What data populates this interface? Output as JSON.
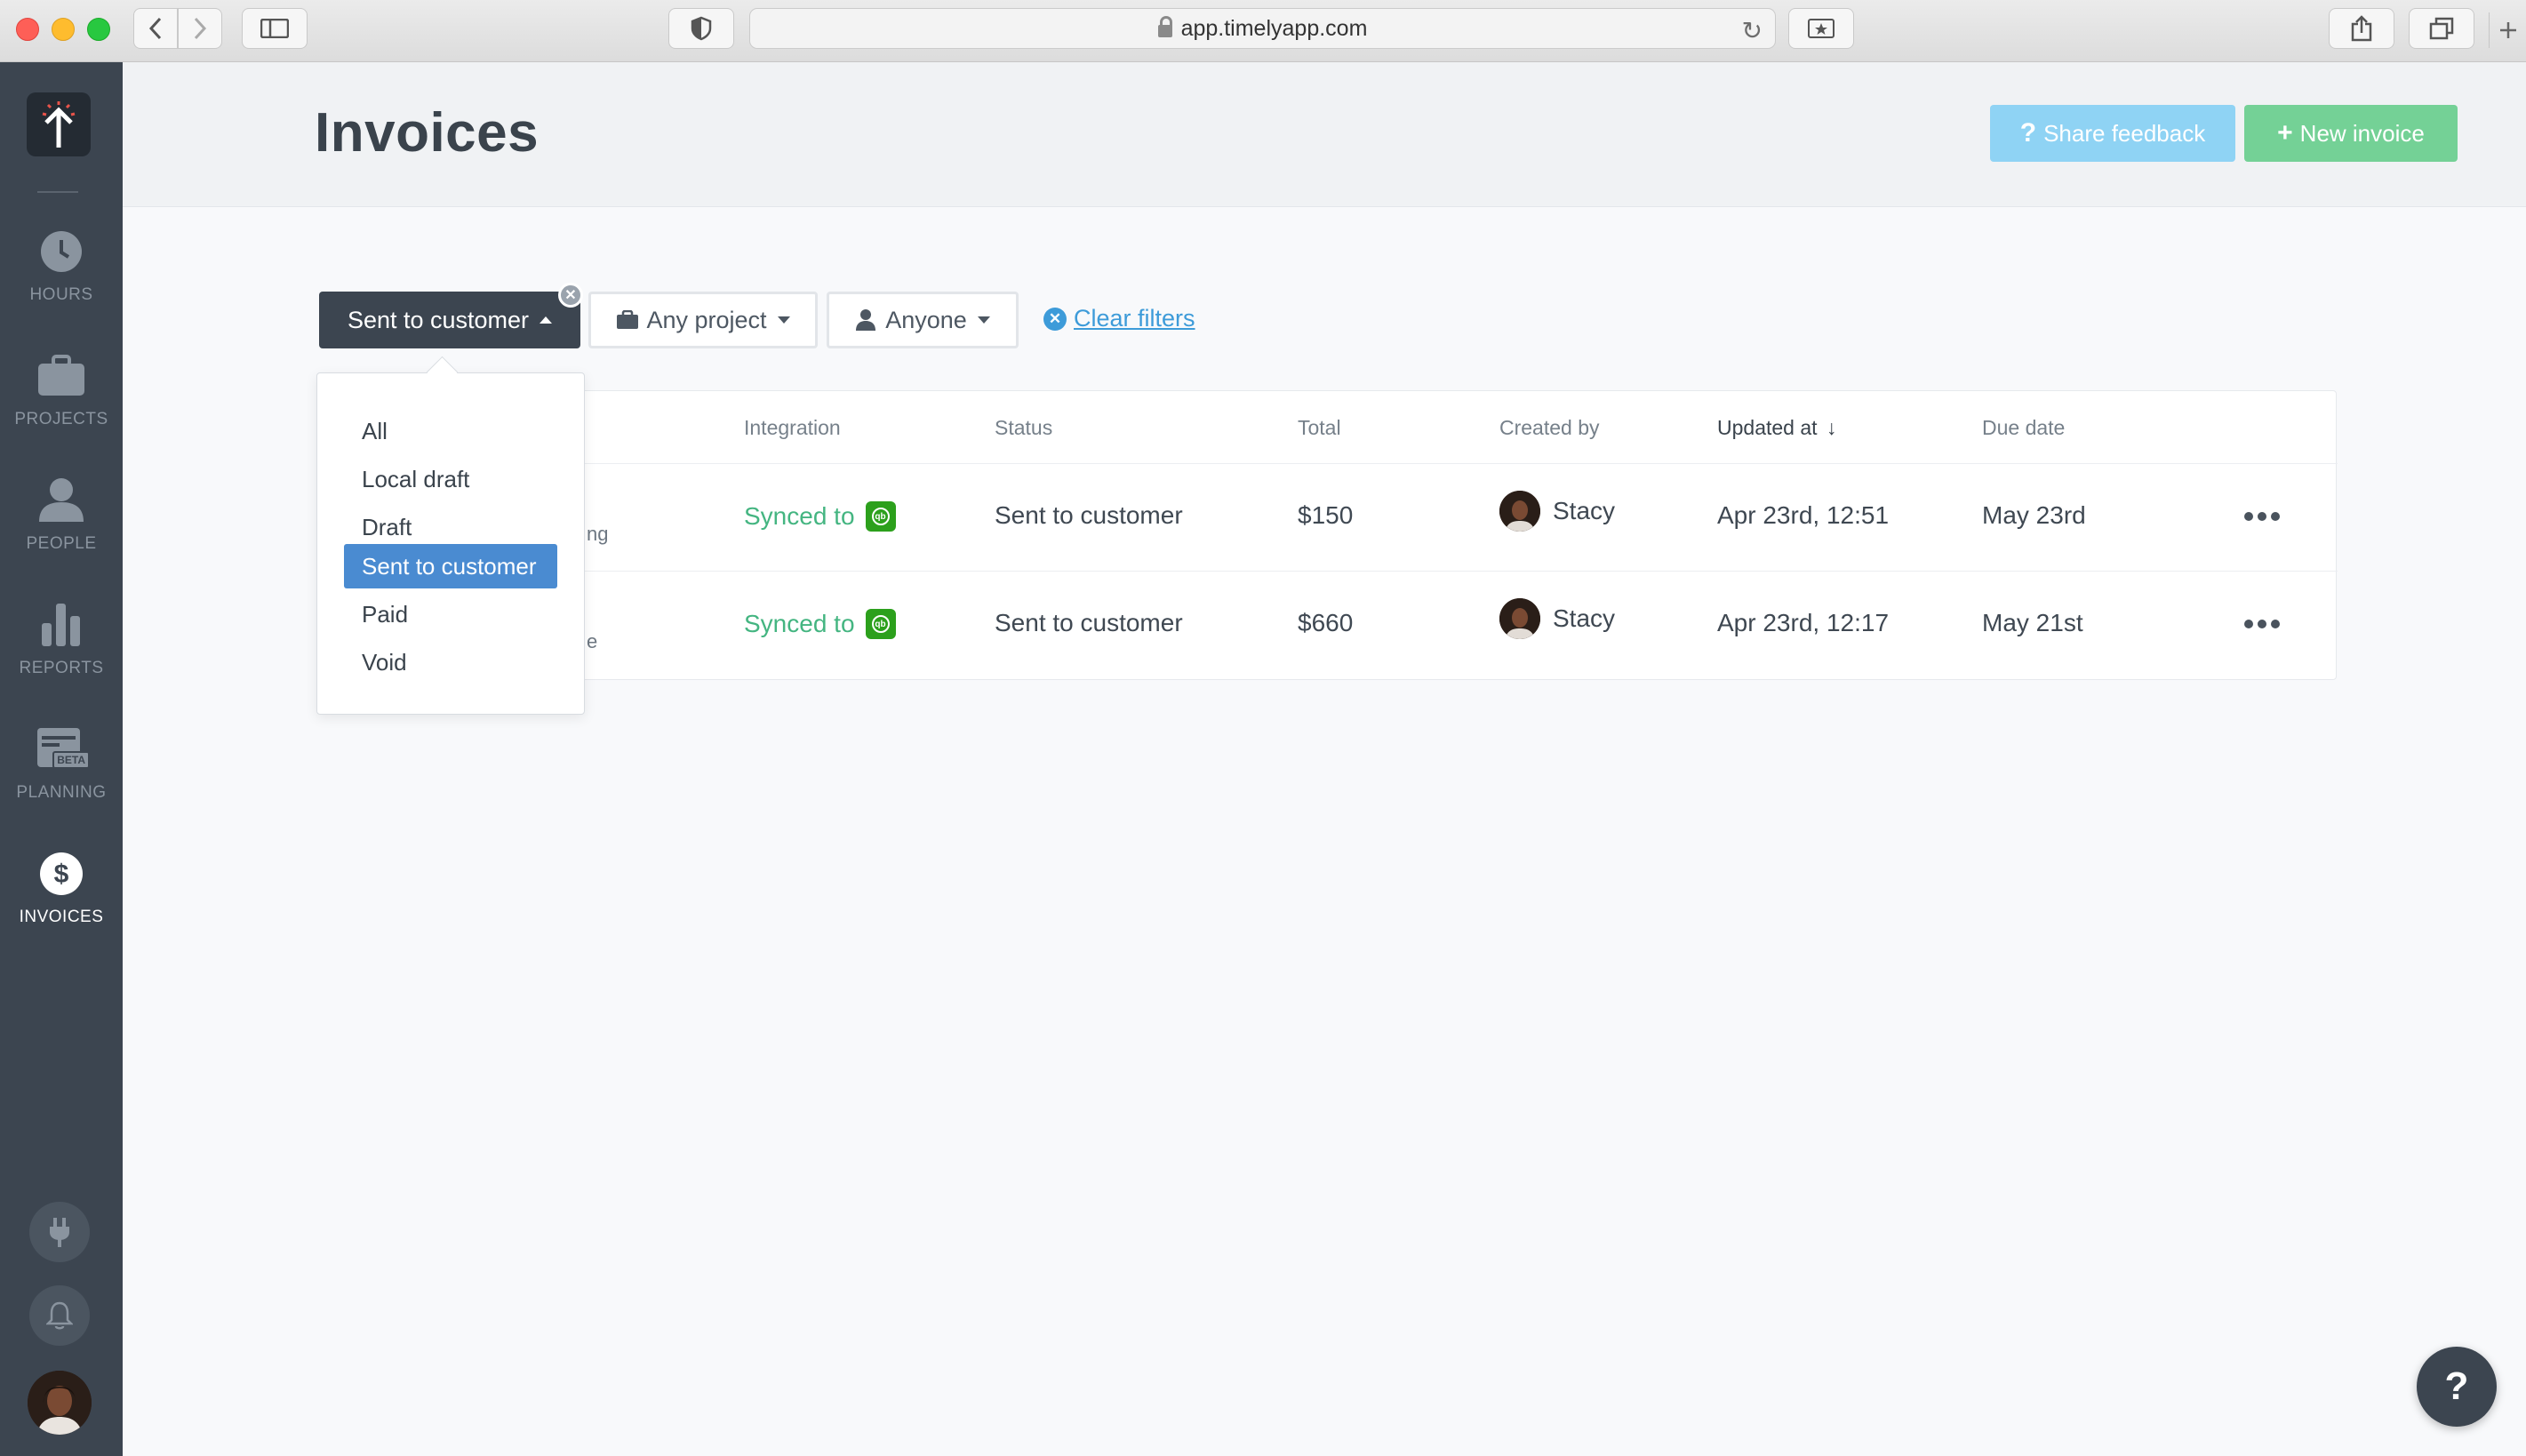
{
  "browser": {
    "url": "app.timelyapp.com"
  },
  "sidebar": {
    "items": [
      {
        "label": "HOURS",
        "icon": "clock-icon"
      },
      {
        "label": "PROJECTS",
        "icon": "briefcase-icon"
      },
      {
        "label": "PEOPLE",
        "icon": "person-icon"
      },
      {
        "label": "REPORTS",
        "icon": "bar-chart-icon"
      },
      {
        "label": "PLANNING",
        "icon": "calendar-icon",
        "badge": "BETA"
      },
      {
        "label": "INVOICES",
        "icon": "dollar-icon",
        "active": true
      }
    ]
  },
  "header": {
    "title": "Invoices",
    "share_feedback": "Share feedback",
    "share_icon": "?",
    "new_invoice": "New invoice",
    "new_icon": "+"
  },
  "filters": {
    "status": "Sent to customer",
    "project": "Any project",
    "person": "Anyone",
    "clear": "Clear filters"
  },
  "dropdown": {
    "options": [
      "All",
      "Local draft",
      "Draft",
      "Sent to customer",
      "Paid",
      "Void"
    ],
    "selected": "Sent to customer"
  },
  "table": {
    "columns": {
      "integration": "Integration",
      "status": "Status",
      "total": "Total",
      "created_by": "Created by",
      "updated_at": "Updated at",
      "due_date": "Due date"
    },
    "rows": [
      {
        "partial": "ng",
        "integration": "Synced to",
        "status": "Sent to customer",
        "total": "$150",
        "created_by": "Stacy",
        "updated_at": "Apr 23rd, 12:51",
        "due_date": "May 23rd"
      },
      {
        "partial": "e",
        "integration": "Synced to",
        "status": "Sent to customer",
        "total": "$660",
        "created_by": "Stacy",
        "updated_at": "Apr 23rd, 12:17",
        "due_date": "May 21st"
      }
    ]
  },
  "help": "?",
  "colors": {
    "sidebar": "#3c4550",
    "share_button": "#8fd3f4",
    "new_button": "#74d196",
    "selected_option": "#4a8bd1",
    "synced": "#44b581"
  }
}
